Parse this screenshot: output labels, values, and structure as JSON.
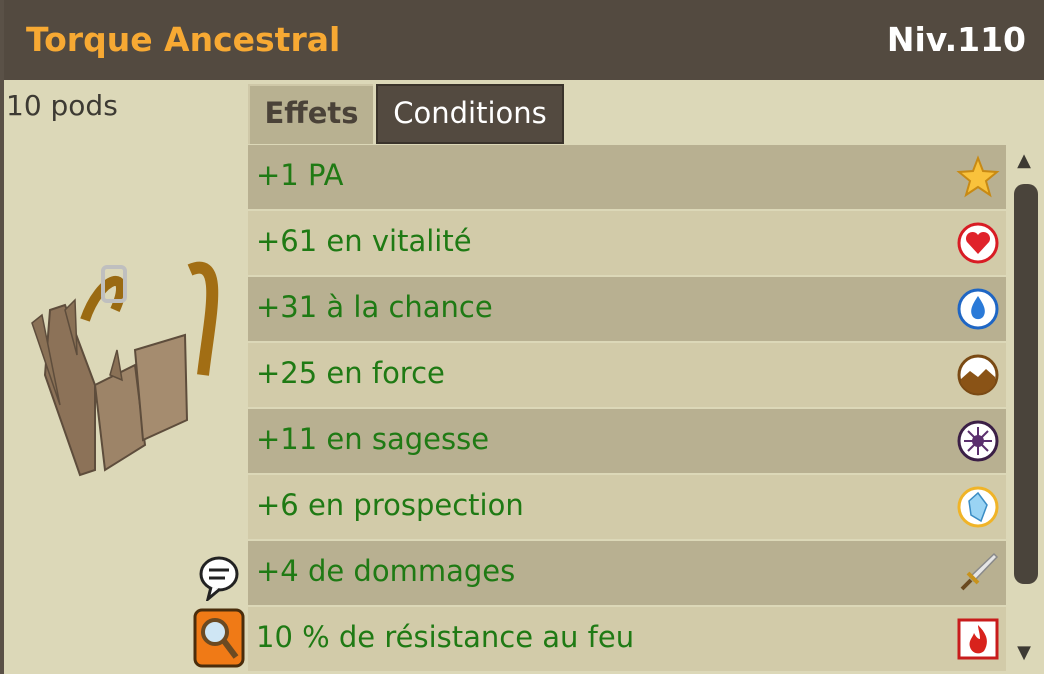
{
  "item": {
    "name": "Torque Ancestral",
    "level": "Niv.110",
    "weight": "10 pods",
    "image_icon": "wooden-belt-icon"
  },
  "tabs": [
    {
      "label": "Effets",
      "active": true
    },
    {
      "label": "Conditions",
      "active": false
    }
  ],
  "effects": [
    {
      "text": "+1 PA",
      "icon": "star-icon"
    },
    {
      "text": "+61 en vitalité",
      "icon": "heart-icon"
    },
    {
      "text": "+31 à la chance",
      "icon": "water-drop-icon"
    },
    {
      "text": "+25 en force",
      "icon": "earth-icon"
    },
    {
      "text": "+11 en sagesse",
      "icon": "wisdom-eye-icon"
    },
    {
      "text": "+6 en prospection",
      "icon": "crystal-icon"
    },
    {
      "text": "+4 de dommages",
      "icon": "sword-icon"
    },
    {
      "text": "10 % de résistance au feu",
      "icon": "fire-icon"
    }
  ],
  "colors": {
    "title": "#f7a933",
    "effect_text": "#1f7a14",
    "header_bg": "#534a40",
    "panel_bg": "#dcd8b8"
  }
}
